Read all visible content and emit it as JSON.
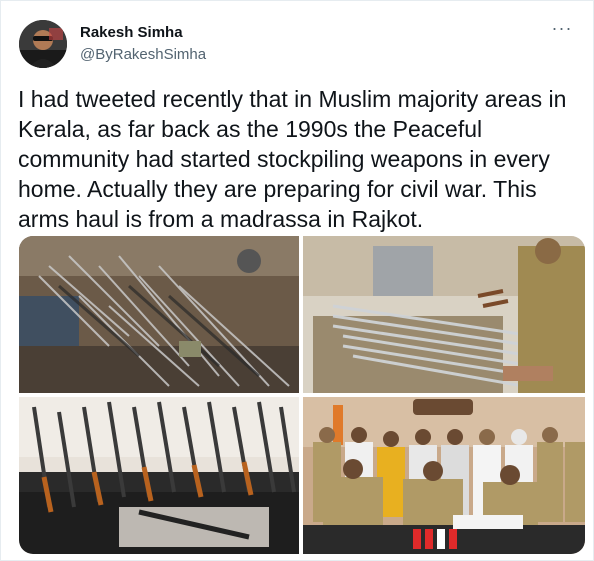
{
  "author": {
    "name": "Rakesh Simha",
    "handle": "@ByRakeshSimha"
  },
  "more_menu": "···",
  "tweet": {
    "text_lines": [
      "I had tweeted recently that in Muslim majority areas in",
      "Kerala, as far back as the 1990s the Peaceful",
      "community had started stockpiling weapons in every",
      "home. Actually they are preparing for civil war. This",
      "arms haul is from a madrassa in Rajkot."
    ]
  },
  "media": {
    "count": 4,
    "images": [
      "swords-on-ground-photo",
      "swords-on-table-photo",
      "rifles-on-sofa-photo",
      "police-press-conference-photo"
    ]
  },
  "colors": {
    "text_primary": "#0f1419",
    "text_secondary": "#536471",
    "border": "#e6ecf0"
  }
}
